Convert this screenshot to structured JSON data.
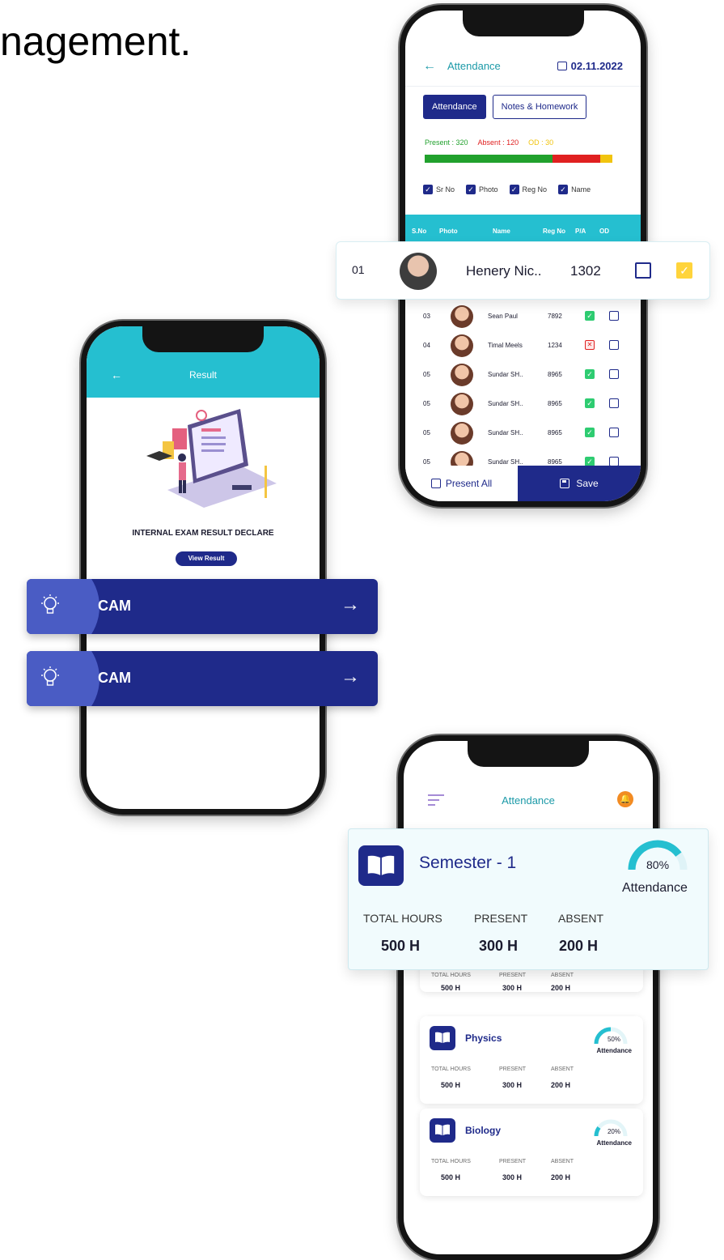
{
  "headline": "nagement.",
  "attendance_screen": {
    "title": "Attendance",
    "date": "02.11.2022",
    "tabs": [
      "Attendance",
      "Notes & Homework"
    ],
    "present_label": "Present : 320",
    "absent_label": "Absent : 120",
    "od_label": "OD : 30",
    "present": 320,
    "absent": 120,
    "od": 30,
    "bar_colors": {
      "present": "#21a12d",
      "absent": "#e02020",
      "od": "#f1c40f"
    },
    "filters": [
      "Sr No",
      "Photo",
      "Reg No",
      "Name"
    ],
    "columns": [
      "S.No",
      "Photo",
      "Name",
      "Reg No",
      "P/A",
      "OD"
    ],
    "highlight_row": {
      "sno": "01",
      "name": "Henery Nic..",
      "reg": "1302"
    },
    "rows": [
      {
        "sno": "03",
        "name": "Sean Paul",
        "reg": "7892",
        "status": "present"
      },
      {
        "sno": "04",
        "name": "Timal Meels",
        "reg": "1234",
        "status": "absent"
      },
      {
        "sno": "05",
        "name": "Sundar SH..",
        "reg": "8965",
        "status": "present"
      },
      {
        "sno": "05",
        "name": "Sundar SH..",
        "reg": "8965",
        "status": "present"
      },
      {
        "sno": "05",
        "name": "Sundar SH..",
        "reg": "8965",
        "status": "present"
      },
      {
        "sno": "05",
        "name": "Sundar SH..",
        "reg": "8965",
        "status": "present"
      }
    ],
    "present_all_label": "Present All",
    "save_label": "Save"
  },
  "result_screen": {
    "title": "Result",
    "heading": "INTERNAL EXAM RESULT DECLARE",
    "button": "View Result"
  },
  "cam_banners": [
    {
      "label": "CAM"
    },
    {
      "label": "CAM"
    }
  ],
  "semester_screen": {
    "title": "Attendance",
    "accent": "#1f2a8a",
    "gauge_color": "#25bfd0",
    "semester": {
      "name": "Semester - 1",
      "percent_label": "80%",
      "percent": 80,
      "attendance_label": "Attendance",
      "labels": [
        "TOTAL HOURS",
        "PRESENT",
        "ABSENT"
      ],
      "values": [
        "500 H",
        "300 H",
        "200 H"
      ]
    },
    "partial_card": {
      "labels": [
        "TOTAL HOURS",
        "PRESENT",
        "ABSENT"
      ],
      "values": [
        "500 H",
        "300 H",
        "200 H"
      ]
    },
    "courses": [
      {
        "name": "Physics",
        "percent_label": "50%",
        "percent": 50,
        "attendance_label": "Attendance",
        "labels": [
          "TOTAL HOURS",
          "PRESENT",
          "ABSENT"
        ],
        "values": [
          "500 H",
          "300 H",
          "200 H"
        ]
      },
      {
        "name": "Biology",
        "percent_label": "20%",
        "percent": 20,
        "attendance_label": "Attendance",
        "labels": [
          "TOTAL HOURS",
          "PRESENT",
          "ABSENT"
        ],
        "values": [
          "500 H",
          "300 H",
          "200 H"
        ]
      }
    ]
  }
}
